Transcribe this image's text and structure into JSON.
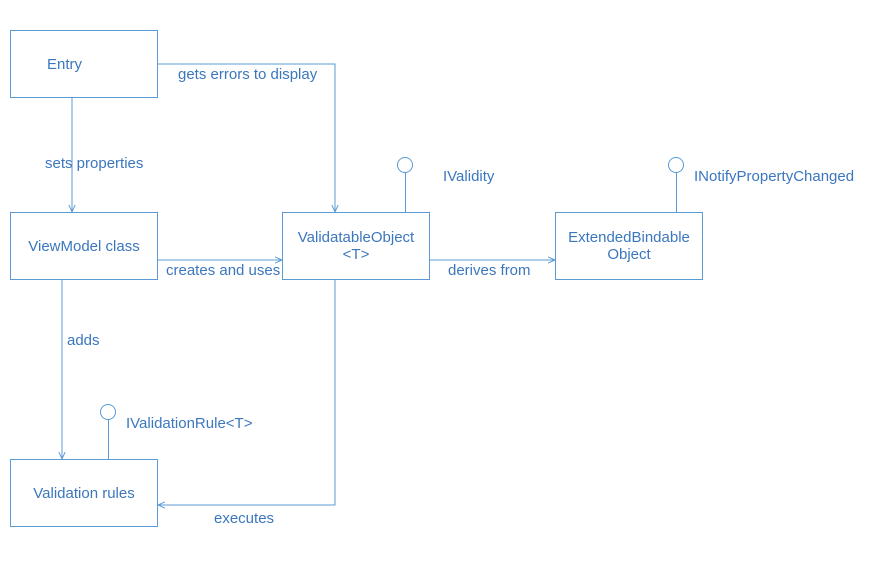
{
  "boxes": {
    "entry": "Entry",
    "viewmodel": "ViewModel class",
    "validatable": "ValidatableObject\n<T>",
    "extendedbindable": "ExtendedBindable\nObject",
    "validationrules": "Validation rules"
  },
  "edges": {
    "gets_errors": "gets errors to display",
    "sets_properties": "sets properties",
    "creates_uses": "creates and uses",
    "derives_from": "derives from",
    "adds": "adds",
    "executes": "executes"
  },
  "interfaces": {
    "ivalidity": "IValidity",
    "inotify": "INotifyPropertyChanged",
    "ivalidationrule": "IValidationRule<T>"
  }
}
